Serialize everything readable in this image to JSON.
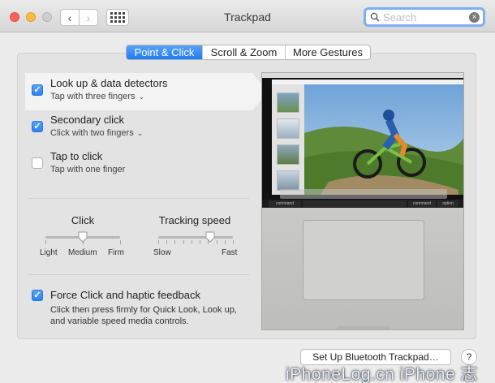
{
  "window": {
    "title": "Trackpad"
  },
  "search": {
    "placeholder": "Search",
    "value": ""
  },
  "tabs": [
    {
      "label": "Point & Click",
      "active": true
    },
    {
      "label": "Scroll & Zoom",
      "active": false
    },
    {
      "label": "More Gestures",
      "active": false
    }
  ],
  "options": [
    {
      "title": "Look up & data detectors",
      "subtitle": "Tap with three fingers",
      "checked": true,
      "selected": true,
      "has_menu": true
    },
    {
      "title": "Secondary click",
      "subtitle": "Click with two fingers",
      "checked": true,
      "selected": false,
      "has_menu": true
    },
    {
      "title": "Tap to click",
      "subtitle": "Tap with one finger",
      "checked": false,
      "selected": false,
      "has_menu": false
    }
  ],
  "sliders": {
    "click": {
      "label": "Click",
      "min_label": "Light",
      "mid_label": "Medium",
      "max_label": "Firm",
      "value_fraction": 0.5,
      "ticks": 3
    },
    "tracking": {
      "label": "Tracking speed",
      "min_label": "Slow",
      "max_label": "Fast",
      "value_fraction": 0.7,
      "ticks": 10
    }
  },
  "force_click": {
    "title": "Force Click and haptic feedback",
    "checked": true,
    "description": "Click then press firmly for Quick Look, Look up, and variable speed media controls."
  },
  "preview": {
    "keys": [
      "command",
      "command",
      "option"
    ]
  },
  "footer": {
    "bluetooth_button": "Set Up Bluetooth Trackpad…",
    "help_label": "?"
  },
  "watermark": "iPhoneLog.cn iPhone 志",
  "colors": {
    "accent": "#2c83f3",
    "window_bg": "#ececec",
    "panel_bg": "#e3e3e3"
  },
  "icons": {
    "back": "chevron-left-icon",
    "forward": "chevron-right-icon",
    "grid": "grid-icon",
    "search": "search-icon",
    "clear": "clear-icon",
    "menu": "chevron-down-icon"
  }
}
